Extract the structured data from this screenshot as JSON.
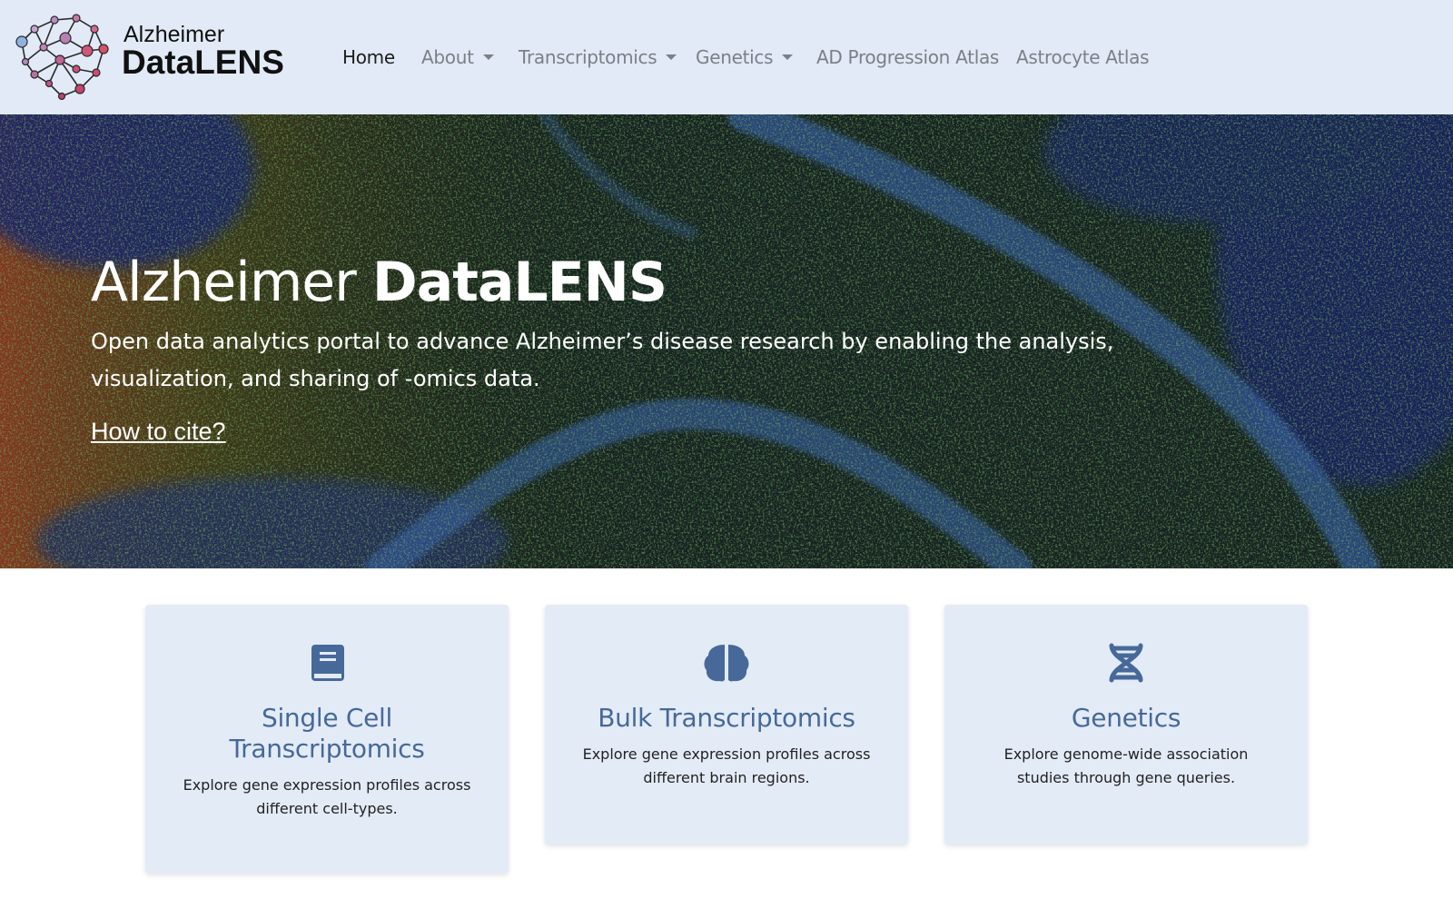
{
  "brand": {
    "top": "Alzheimer",
    "bottom": "DataLENS"
  },
  "nav": {
    "home": "Home",
    "about": "About",
    "transcriptomics": "Transcriptomics",
    "genetics": "Genetics",
    "ad_progression_atlas": "AD Progression Atlas",
    "astrocyte_atlas": "Astrocyte Atlas"
  },
  "hero": {
    "title_light": "Alzheimer ",
    "title_bold": "DataLENS",
    "subtitle": "Open data analytics portal to advance Alzheimer’s disease research by enabling the analysis, visualization, and sharing of -omics data.",
    "cite_link": "How to cite?"
  },
  "cards": [
    {
      "icon": "book-icon",
      "title": "Single Cell Transcriptomics",
      "description": "Explore gene expression profiles across different cell-types."
    },
    {
      "icon": "brain-icon",
      "title": "Bulk Transcriptomics",
      "description": "Explore gene expression profiles across different brain regions."
    },
    {
      "icon": "dna-icon",
      "title": "Genetics",
      "description": "Explore genome-wide association studies through gene queries."
    }
  ],
  "colors": {
    "navbar_bg": "#e1eaf6",
    "card_bg": "#e3ebf7",
    "accent": "#46699a",
    "nav_text": "#7b8087"
  }
}
